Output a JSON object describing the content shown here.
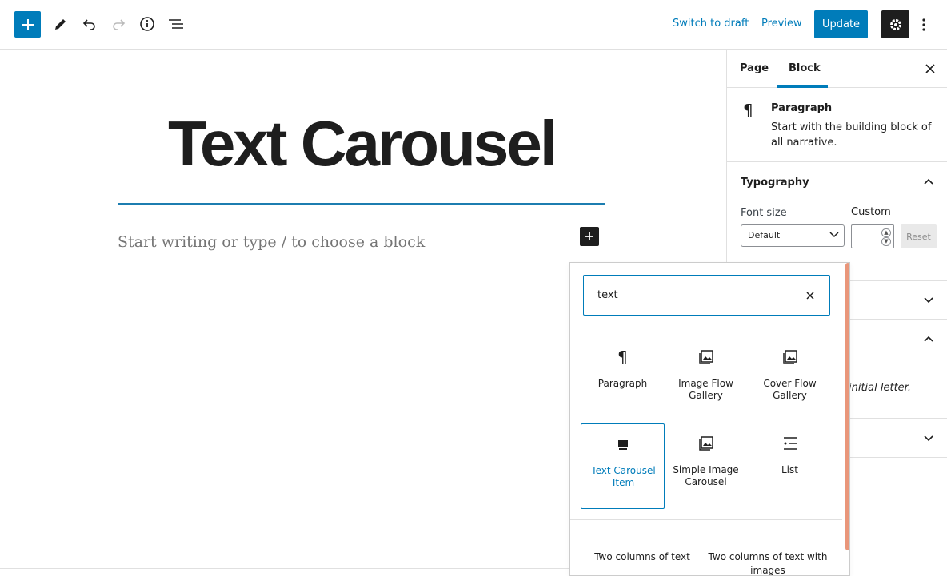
{
  "toolbar": {
    "add_block_icon": "plus-icon",
    "tools_icon": "pencil-icon",
    "undo_icon": "undo-icon",
    "redo_icon": "redo-icon",
    "details_icon": "info-icon",
    "list_view_icon": "list-view-icon",
    "switch_to_draft": "Switch to draft",
    "preview": "Preview",
    "update": "Update",
    "settings_icon": "gear-icon",
    "more_icon": "more-vertical-icon"
  },
  "canvas": {
    "post_title": "Text Carousel",
    "placeholder": "Start writing or type / to choose a block"
  },
  "sidebar": {
    "tabs": [
      {
        "label": "Page"
      },
      {
        "label": "Block"
      }
    ],
    "active_tab": "Block",
    "block_card": {
      "icon": "paragraph-icon",
      "title": "Paragraph",
      "description": "Start with the building block of all narrative."
    },
    "typography": {
      "title": "Typography",
      "font_size_label": "Font size",
      "custom_label": "Custom",
      "font_size_value": "Default",
      "custom_value": "",
      "reset": "Reset"
    },
    "drop_cap_hint": "initial letter."
  },
  "inserter": {
    "search_value": "text",
    "blocks": [
      {
        "label": "Paragraph",
        "icon": "paragraph-icon"
      },
      {
        "label": "Image Flow Gallery",
        "icon": "gallery-icon"
      },
      {
        "label": "Cover Flow Gallery",
        "icon": "gallery-icon"
      },
      {
        "label": "Text Carousel Item",
        "icon": "carousel-item-icon",
        "selected": true
      },
      {
        "label": "Simple Image Carousel",
        "icon": "gallery-icon"
      },
      {
        "label": "List",
        "icon": "list-icon"
      }
    ],
    "patterns": [
      {
        "label": "Two columns of text"
      },
      {
        "label": "Two columns of text with images"
      }
    ]
  },
  "colors": {
    "accent": "#007cba",
    "dark": "#1e1e1e",
    "scrollbar": "#e9967a"
  }
}
